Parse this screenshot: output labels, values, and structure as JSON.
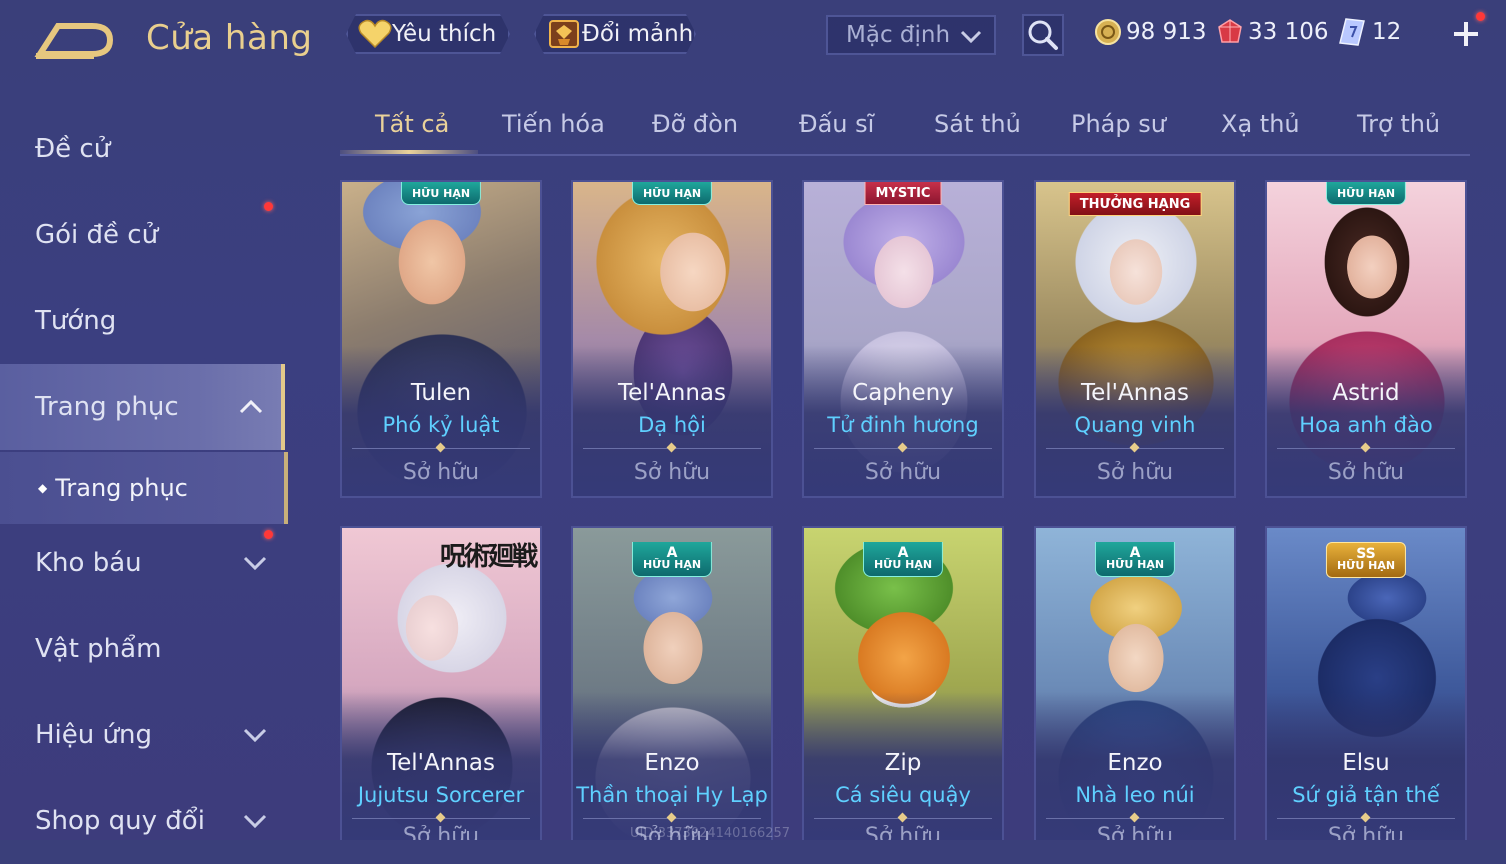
{
  "header": {
    "title": "Cửa hàng",
    "favorites_label": "Yêu thích",
    "exchange_label": "Đổi mảnh",
    "sort_value": "Mặc định",
    "currencies": [
      {
        "icon": "gold-coin-icon",
        "value": "98 913"
      },
      {
        "icon": "red-gem-icon",
        "value": "33 106"
      },
      {
        "icon": "ticket-icon",
        "value": "12"
      }
    ]
  },
  "sidebar": {
    "items": [
      {
        "label": "Đề cử"
      },
      {
        "label": "Gói đề cử"
      },
      {
        "label": "Tướng"
      },
      {
        "label": "Trang phục"
      },
      {
        "label": "Trang phục"
      },
      {
        "label": "Kho báu"
      },
      {
        "label": "Vật phẩm"
      },
      {
        "label": "Hiệu ứng"
      },
      {
        "label": "Shop quy đổi"
      }
    ]
  },
  "tabs": [
    {
      "label": "Tất cả"
    },
    {
      "label": "Tiến hóa"
    },
    {
      "label": "Đỡ đòn"
    },
    {
      "label": "Đấu sĩ"
    },
    {
      "label": "Sát thủ"
    },
    {
      "label": "Pháp sư"
    },
    {
      "label": "Xạ thủ"
    },
    {
      "label": "Trợ thủ"
    }
  ],
  "cards": [
    {
      "hero": "Tulen",
      "skin": "Phó kỷ luật",
      "status": "Sở hữu",
      "badge": "HỮU HẠN"
    },
    {
      "hero": "Tel'Annas",
      "skin": "Dạ hội",
      "status": "Sở hữu",
      "badge": "HỮU HẠN"
    },
    {
      "hero": "Capheny",
      "skin": "Tử đinh hương",
      "status": "Sở hữu",
      "badge": "MYSTIC"
    },
    {
      "hero": "Tel'Annas",
      "skin": "Quang vinh",
      "status": "Sở hữu",
      "badge": "THƯỞNG HẠNG"
    },
    {
      "hero": "Astrid",
      "skin": "Hoa anh đào",
      "status": "Sở hữu",
      "badge": "HỮU HẠN"
    },
    {
      "hero": "Tel'Annas",
      "skin": "Jujutsu Sorcerer",
      "status": "Sở hữu",
      "badge": "呪術廻戦"
    },
    {
      "hero": "Enzo",
      "skin": "Thần thoại Hy Lạp",
      "status": "Sở hữu",
      "badge_tier": "A",
      "badge": "HỮU HẠN"
    },
    {
      "hero": "Zip",
      "skin": "Cá siêu quậy",
      "status": "Sở hữu",
      "badge_tier": "A",
      "badge": "HỮU HẠN"
    },
    {
      "hero": "Enzo",
      "skin": "Nhà leo núi",
      "status": "Sở hữu",
      "badge_tier": "A",
      "badge": "HỮU HẠN"
    },
    {
      "hero": "Elsu",
      "skin": "Sứ giả tận thế",
      "status": "Sở hữu",
      "badge_tier": "SS",
      "badge": "HỮU HẠN"
    }
  ],
  "watermark": "UID:3373024140166257",
  "colors": {
    "accent_gold": "#ead29a",
    "skin_name_blue": "#5fd0ff",
    "notification_red": "#ff3838",
    "background": "#3b3f80"
  }
}
